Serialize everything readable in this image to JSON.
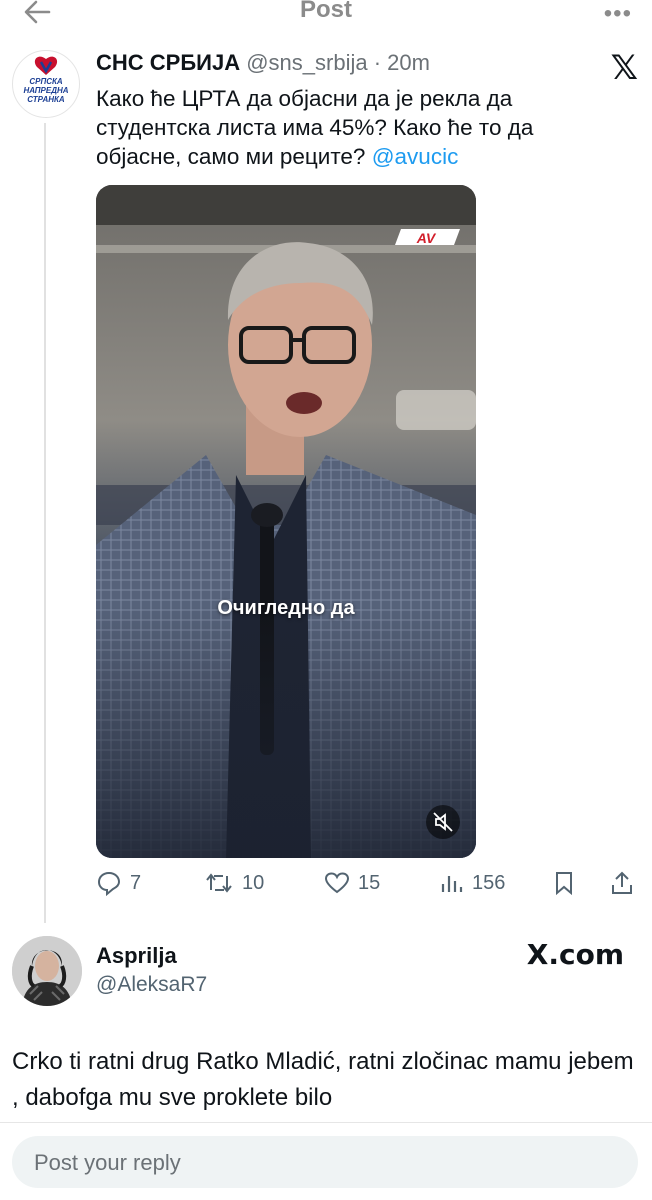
{
  "header": {
    "title": "Post"
  },
  "post": {
    "author_name": "СНС СРБИЈА",
    "meta": "@sns_srbija · 20m",
    "text": "Како ће ЦРТА да објасни да је рекла да студентска листа има 45%? Како ће то да објасне, само ми реците? ",
    "mention": "@avucic",
    "avatar_logo_text": [
      "СРПСКА",
      "НАПРЕДНА",
      "СТРАНКА"
    ],
    "video": {
      "watermark": "AV",
      "caption": "Очигледно да"
    },
    "stats": {
      "replies": "7",
      "reposts": "10",
      "likes": "15",
      "views": "156"
    }
  },
  "reply": {
    "name": "Asprilja",
    "handle": "@AleksaR7",
    "brand": "X.com",
    "text": "Crko ti ratni drug Ratko Mladić,  ratni zločinac mamu jebem , dabofga mu sve proklete bilo"
  },
  "composer": {
    "placeholder": "Post your reply"
  },
  "colors": {
    "accent": "#1d9bf0",
    "muted": "#536471",
    "logo_red": "#c8102e",
    "logo_blue": "#1c3f94"
  }
}
